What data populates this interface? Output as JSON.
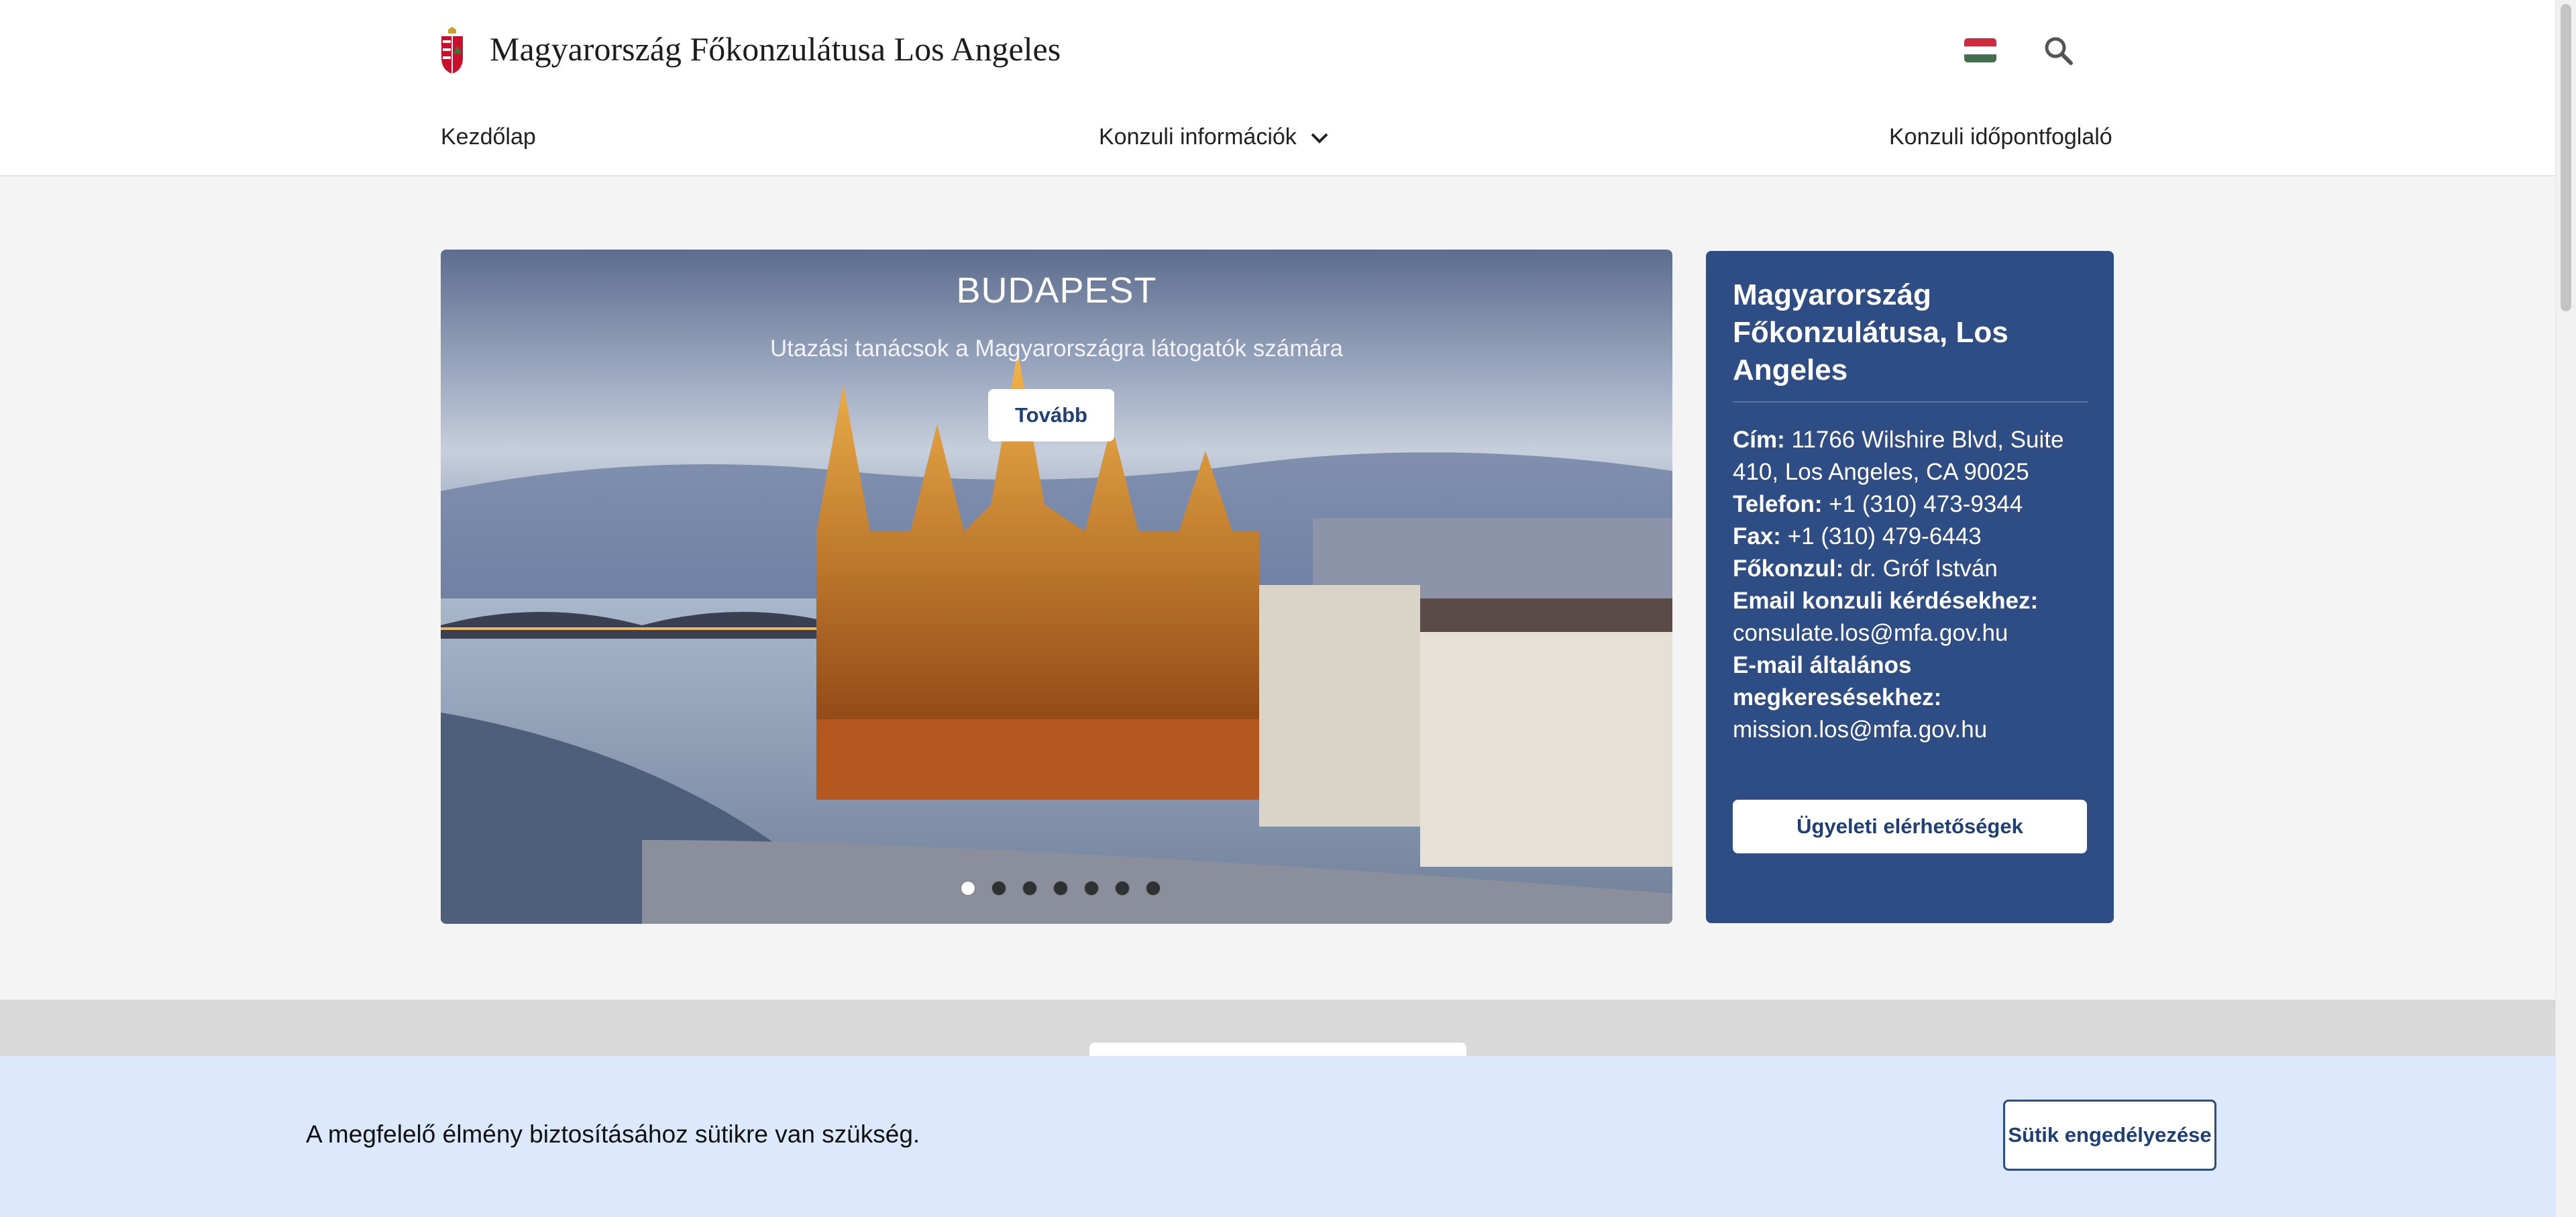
{
  "header": {
    "site_title": "Magyarország Főkonzulátusa Los Angeles",
    "logo_icon": "coat-of-arms-icon",
    "language_icon": "hungarian-flag-icon",
    "search_icon": "search-icon"
  },
  "nav": {
    "items": [
      {
        "label": "Kezdőlap"
      },
      {
        "label": "Konzuli információk",
        "has_dropdown": true
      },
      {
        "label": "Konzuli időpontfoglaló"
      }
    ]
  },
  "hero": {
    "title": "BUDAPEST",
    "subtitle": "Utazási tanácsok a Magyarországra látogatók számára",
    "button_label": "Tovább",
    "slide_count": 7,
    "active_slide": 1
  },
  "info_card": {
    "title": "Magyarország Főkonzulátusa, Los Angeles",
    "address_label": "Cím:",
    "address_value": "11766 Wilshire Blvd, Suite 410, Los Angeles, CA 90025",
    "phone_label": "Telefon:",
    "phone_value": "+1 (310) 473-9344",
    "fax_label": "Fax:",
    "fax_value": "+1 (310) 479-6443",
    "consul_label": "Főkonzul:",
    "consul_value": "dr. Gróf István",
    "consular_email_label": "Email konzuli kérdésekhez:",
    "consular_email_value": "consulate.los@mfa.gov.hu",
    "general_email_label": "E-mail általános megkeresésekhez:",
    "general_email_value": "mission.los@mfa.gov.hu",
    "button_label": "Ügyeleti elérhetőségek"
  },
  "cookie_bar": {
    "text": "A megfelelő élmény biztosításához sütikre van szükség.",
    "button_label": "Sütik engedélyezése"
  },
  "colors": {
    "brand_blue": "#2f4d85",
    "cookie_bg": "#dce8fb",
    "page_bg": "#f4f4f4"
  }
}
